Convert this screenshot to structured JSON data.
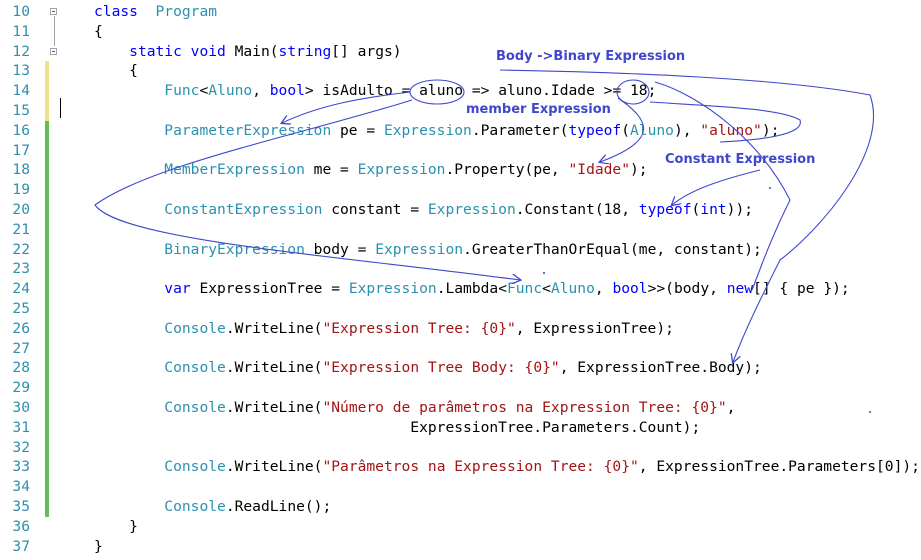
{
  "editor": {
    "lines": [
      {
        "n": "10",
        "tokens": [
          [
            "kw",
            "class"
          ],
          [
            "",
            "  "
          ],
          [
            "typ",
            "Program"
          ]
        ]
      },
      {
        "n": "11",
        "tokens": [
          [
            "",
            "{"
          ]
        ]
      },
      {
        "n": "12",
        "tokens": [
          [
            "",
            "    "
          ],
          [
            "kw",
            "static"
          ],
          [
            "",
            " "
          ],
          [
            "kw",
            "void"
          ],
          [
            "",
            " Main("
          ],
          [
            "kw",
            "string"
          ],
          [
            "",
            "[] args)"
          ]
        ]
      },
      {
        "n": "13",
        "tokens": [
          [
            "",
            "    {"
          ]
        ]
      },
      {
        "n": "14",
        "tokens": [
          [
            "",
            "        "
          ],
          [
            "typ",
            "Func"
          ],
          [
            "",
            "<"
          ],
          [
            "typ",
            "Aluno"
          ],
          [
            "",
            ", "
          ],
          [
            "kw",
            "bool"
          ],
          [
            "",
            "> isAdulto = aluno => aluno.Idade >= 18;"
          ]
        ]
      },
      {
        "n": "15",
        "tokens": [
          [
            "",
            ""
          ]
        ]
      },
      {
        "n": "16",
        "tokens": [
          [
            "",
            "        "
          ],
          [
            "typ",
            "ParameterExpression"
          ],
          [
            "",
            " pe = "
          ],
          [
            "typ",
            "Expression"
          ],
          [
            "",
            ".Parameter("
          ],
          [
            "kw",
            "typeof"
          ],
          [
            "",
            "("
          ],
          [
            "typ",
            "Aluno"
          ],
          [
            "",
            "), "
          ],
          [
            "str",
            "\"aluno\""
          ],
          [
            "",
            ");"
          ]
        ]
      },
      {
        "n": "17",
        "tokens": [
          [
            "",
            ""
          ]
        ]
      },
      {
        "n": "18",
        "tokens": [
          [
            "",
            "        "
          ],
          [
            "typ",
            "MemberExpression"
          ],
          [
            "",
            " me = "
          ],
          [
            "typ",
            "Expression"
          ],
          [
            "",
            ".Property(pe, "
          ],
          [
            "str",
            "\"Idade\""
          ],
          [
            "",
            ");"
          ]
        ]
      },
      {
        "n": "19",
        "tokens": [
          [
            "",
            ""
          ]
        ]
      },
      {
        "n": "20",
        "tokens": [
          [
            "",
            "        "
          ],
          [
            "typ",
            "ConstantExpression"
          ],
          [
            "",
            " constant = "
          ],
          [
            "typ",
            "Expression"
          ],
          [
            "",
            ".Constant(18, "
          ],
          [
            "kw",
            "typeof"
          ],
          [
            "",
            "("
          ],
          [
            "kw",
            "int"
          ],
          [
            "",
            "));"
          ]
        ]
      },
      {
        "n": "21",
        "tokens": [
          [
            "",
            ""
          ]
        ]
      },
      {
        "n": "22",
        "tokens": [
          [
            "",
            "        "
          ],
          [
            "typ",
            "BinaryExpression"
          ],
          [
            "",
            " body = "
          ],
          [
            "typ",
            "Expression"
          ],
          [
            "",
            ".GreaterThanOrEqual(me, constant);"
          ]
        ]
      },
      {
        "n": "23",
        "tokens": [
          [
            "",
            ""
          ]
        ]
      },
      {
        "n": "24",
        "tokens": [
          [
            "",
            "        "
          ],
          [
            "kw",
            "var"
          ],
          [
            "",
            " ExpressionTree = "
          ],
          [
            "typ",
            "Expression"
          ],
          [
            "",
            ".Lambda<"
          ],
          [
            "typ",
            "Func"
          ],
          [
            "",
            "<"
          ],
          [
            "typ",
            "Aluno"
          ],
          [
            "",
            ", "
          ],
          [
            "kw",
            "bool"
          ],
          [
            "",
            ">>(body, "
          ],
          [
            "kw",
            "new"
          ],
          [
            "",
            "[] { pe });"
          ]
        ]
      },
      {
        "n": "25",
        "tokens": [
          [
            "",
            ""
          ]
        ]
      },
      {
        "n": "26",
        "tokens": [
          [
            "",
            "        "
          ],
          [
            "typ",
            "Console"
          ],
          [
            "",
            ".WriteLine("
          ],
          [
            "str",
            "\"Expression Tree: {0}\""
          ],
          [
            "",
            ", ExpressionTree);"
          ]
        ]
      },
      {
        "n": "27",
        "tokens": [
          [
            "",
            ""
          ]
        ]
      },
      {
        "n": "28",
        "tokens": [
          [
            "",
            "        "
          ],
          [
            "typ",
            "Console"
          ],
          [
            "",
            ".WriteLine("
          ],
          [
            "str",
            "\"Expression Tree Body: {0}\""
          ],
          [
            "",
            ", ExpressionTree.Body);"
          ]
        ]
      },
      {
        "n": "29",
        "tokens": [
          [
            "",
            ""
          ]
        ]
      },
      {
        "n": "30",
        "tokens": [
          [
            "",
            "        "
          ],
          [
            "typ",
            "Console"
          ],
          [
            "",
            ".WriteLine("
          ],
          [
            "str",
            "\"Número de parâmetros na Expression Tree: {0}\""
          ],
          [
            "",
            ","
          ]
        ]
      },
      {
        "n": "31",
        "tokens": [
          [
            "",
            "                                    ExpressionTree.Parameters.Count);"
          ]
        ]
      },
      {
        "n": "32",
        "tokens": [
          [
            "",
            ""
          ]
        ]
      },
      {
        "n": "33",
        "tokens": [
          [
            "",
            "        "
          ],
          [
            "typ",
            "Console"
          ],
          [
            "",
            ".WriteLine("
          ],
          [
            "str",
            "\"Parâmetros na Expression Tree: {0}\""
          ],
          [
            "",
            ", ExpressionTree.Parameters[0]);"
          ]
        ]
      },
      {
        "n": "34",
        "tokens": [
          [
            "",
            ""
          ]
        ]
      },
      {
        "n": "35",
        "tokens": [
          [
            "",
            "        "
          ],
          [
            "typ",
            "Console"
          ],
          [
            "",
            ".ReadLine();"
          ]
        ]
      },
      {
        "n": "36",
        "tokens": [
          [
            "",
            "    }"
          ]
        ]
      },
      {
        "n": "37",
        "tokens": [
          [
            "",
            "}"
          ]
        ]
      }
    ],
    "change_bars": {
      "yellow_lines": [
        "13",
        "14",
        "15"
      ],
      "green_lines": [
        "16",
        "17",
        "18",
        "19",
        "20",
        "21",
        "22",
        "23",
        "24",
        "25",
        "26",
        "27",
        "28",
        "29",
        "30",
        "31",
        "32",
        "33",
        "34",
        "35"
      ]
    },
    "colors": {
      "keyword": "#0000ff",
      "type": "#2b91af",
      "string": "#a31515",
      "annotation": "#3f48cc",
      "bar_yellow": "#efe38a",
      "bar_green": "#5fbf5f"
    }
  },
  "annotations": {
    "body_label": "Body ->Binary Expression",
    "member_label": "member Expression",
    "constant_label": "Constant Expression"
  }
}
